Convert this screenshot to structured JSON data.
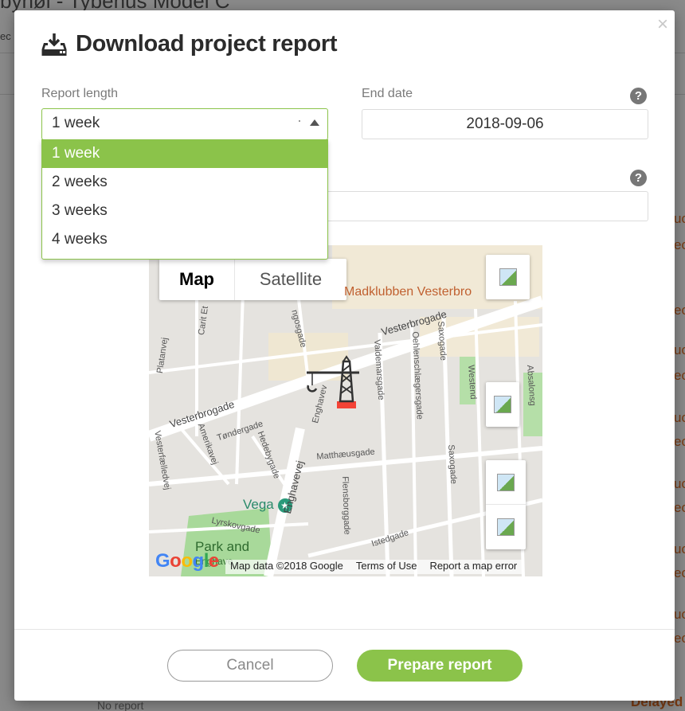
{
  "background": {
    "title": "byhøl - Tybenus Model C",
    "subtitle": "ec",
    "right_fragments": [
      "uc",
      "ec",
      "ec",
      "uc",
      "ec",
      "uc",
      "ec",
      "uc",
      "ec",
      "uc",
      "ec",
      "uc",
      "ec"
    ],
    "delayed_label": "Delayed",
    "no_report_label": "No report"
  },
  "modal": {
    "title": "Download project report",
    "close_symbol": "×",
    "report_length": {
      "label": "Report length",
      "selected": "1 week",
      "options": [
        "1 week",
        "2 weeks",
        "3 weeks",
        "4 weeks"
      ]
    },
    "end_date": {
      "label": "End date",
      "value": "2018-09-06"
    },
    "help_symbol": "?",
    "map": {
      "type_map": "Map",
      "type_satellite": "Satellite",
      "poi": "Madklubben Vesterbro",
      "vega": "Vega",
      "park": "Park and",
      "park_line2": "Enghave",
      "streets": {
        "vesterbrogade": "Vesterbrogade",
        "vesterbrogade2": "Vesterbrogade",
        "enghavevej": "Enghavevej",
        "enghavevej2": "Enghavev",
        "valdemarsgade": "Valdemarsgade",
        "oehlenschlaegersgade": "Oehlenschlægersgade",
        "saxogade": "Saxogade",
        "saxogade2": "Saxogade",
        "westend": "Westend",
        "absalonsgade": "Absalonsg",
        "matthaeusgade": "Matthæusgade",
        "toendergade": "Tøndergade",
        "hedebygade": "Hedebygade",
        "amerikavej": "Amerikavej",
        "vesterfaelledvej": "Vesterfælledvej",
        "flensborggade": "Flensborggade",
        "istedgade": "Istedgade",
        "lyrskovgade": "Lyrskovgade",
        "platanvej": "Platanvej",
        "carit": "Carit Et",
        "ingosgade": "ngosgade"
      },
      "google_letters": [
        "G",
        "o",
        "o",
        "g",
        "l",
        "e"
      ],
      "attribution": {
        "data": "Map data ©2018 Google",
        "terms": "Terms of Use",
        "report": "Report a map error"
      }
    },
    "buttons": {
      "cancel": "Cancel",
      "prepare": "Prepare report"
    }
  },
  "colors": {
    "accent": "#8bc34a",
    "crane": "#333333",
    "crane_base": "#f44336"
  }
}
